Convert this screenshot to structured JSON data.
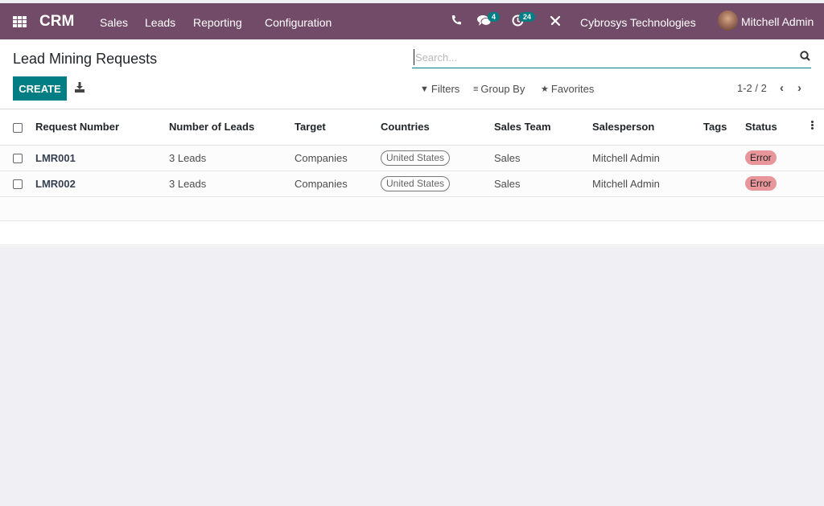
{
  "navbar": {
    "brand": "CRM",
    "menu": [
      "Sales",
      "Leads",
      "Reporting",
      "Configuration"
    ],
    "messages_count": "4",
    "activities_count": "24",
    "company": "Cybrosys Technologies",
    "user": "Mitchell Admin",
    "accent": "#714b67"
  },
  "control_panel": {
    "title": "Lead Mining Requests",
    "create_label": "CREATE",
    "search_placeholder": "Search...",
    "filters_label": "Filters",
    "group_by_label": "Group By",
    "favorites_label": "Favorites",
    "pager": "1-2 / 2"
  },
  "table": {
    "columns": [
      "Request Number",
      "Number of Leads",
      "Target",
      "Countries",
      "Sales Team",
      "Salesperson",
      "Tags",
      "Status"
    ],
    "rows": [
      {
        "request_number": "LMR001",
        "leads": "3 Leads",
        "target": "Companies",
        "country": "United States",
        "team": "Sales",
        "salesperson": "Mitchell Admin",
        "tags": "",
        "status": "Error"
      },
      {
        "request_number": "LMR002",
        "leads": "3 Leads",
        "target": "Companies",
        "country": "United States",
        "team": "Sales",
        "salesperson": "Mitchell Admin",
        "tags": "",
        "status": "Error"
      }
    ]
  },
  "colors": {
    "primary": "#017e84",
    "error": "#e9969b"
  }
}
